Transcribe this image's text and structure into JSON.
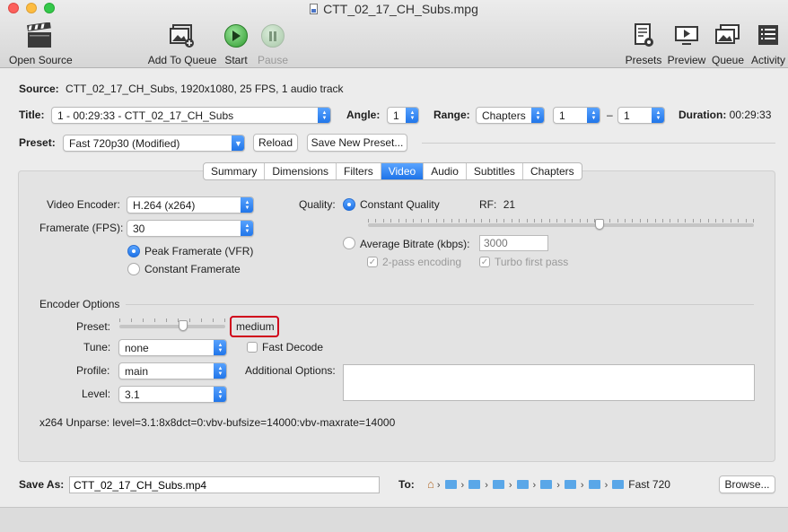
{
  "window": {
    "title": "CTT_02_17_CH_Subs.mpg"
  },
  "toolbar": {
    "open_source": "Open Source",
    "add_to_queue": "Add To Queue",
    "start": "Start",
    "pause": "Pause",
    "presets": "Presets",
    "preview": "Preview",
    "queue": "Queue",
    "activity": "Activity"
  },
  "source": {
    "label": "Source:",
    "value": "CTT_02_17_CH_Subs, 1920x1080, 25 FPS, 1 audio track"
  },
  "title_row": {
    "title_label": "Title:",
    "title_value": "1 - 00:29:33 - CTT_02_17_CH_Subs",
    "angle_label": "Angle:",
    "angle_value": "1",
    "range_label": "Range:",
    "range_value": "Chapters",
    "range_start": "1",
    "range_dash": "–",
    "range_end": "1",
    "duration_label": "Duration:",
    "duration_value": "00:29:33"
  },
  "preset_row": {
    "label": "Preset:",
    "value": "Fast 720p30 (Modified)",
    "reload": "Reload",
    "save_new": "Save New Preset..."
  },
  "tabs": [
    "Summary",
    "Dimensions",
    "Filters",
    "Video",
    "Audio",
    "Subtitles",
    "Chapters"
  ],
  "active_tab": "Video",
  "video": {
    "encoder_label": "Video Encoder:",
    "encoder_value": "H.264 (x264)",
    "framerate_label": "Framerate (FPS):",
    "framerate_value": "30",
    "peak_framerate": "Peak Framerate (VFR)",
    "constant_framerate": "Constant Framerate",
    "quality_label": "Quality:",
    "constant_quality": "Constant Quality",
    "rf_label": "RF:",
    "rf_value": "21",
    "quality_slider_position": 0.6,
    "average_bitrate": "Average Bitrate (kbps):",
    "bitrate_placeholder": "3000",
    "two_pass": "2-pass encoding",
    "turbo": "Turbo first pass"
  },
  "encoder_options": {
    "heading": "Encoder Options",
    "preset_label": "Preset:",
    "preset_value": "medium",
    "preset_slider_position": 0.6,
    "tune_label": "Tune:",
    "tune_value": "none",
    "fast_decode": "Fast Decode",
    "profile_label": "Profile:",
    "profile_value": "main",
    "additional_label": "Additional Options:",
    "level_label": "Level:",
    "level_value": "3.1",
    "unparse": "x264 Unparse: level=3.1:8x8dct=0:vbv-bufsize=14000:vbv-maxrate=14000"
  },
  "save_row": {
    "label": "Save As:",
    "value": "CTT_02_17_CH_Subs.mp4",
    "to_label": "To:",
    "last_folder": "Fast 720",
    "browse": "Browse..."
  },
  "colors": {
    "accent": "#1e73e8",
    "highlight": "#d0021b"
  }
}
